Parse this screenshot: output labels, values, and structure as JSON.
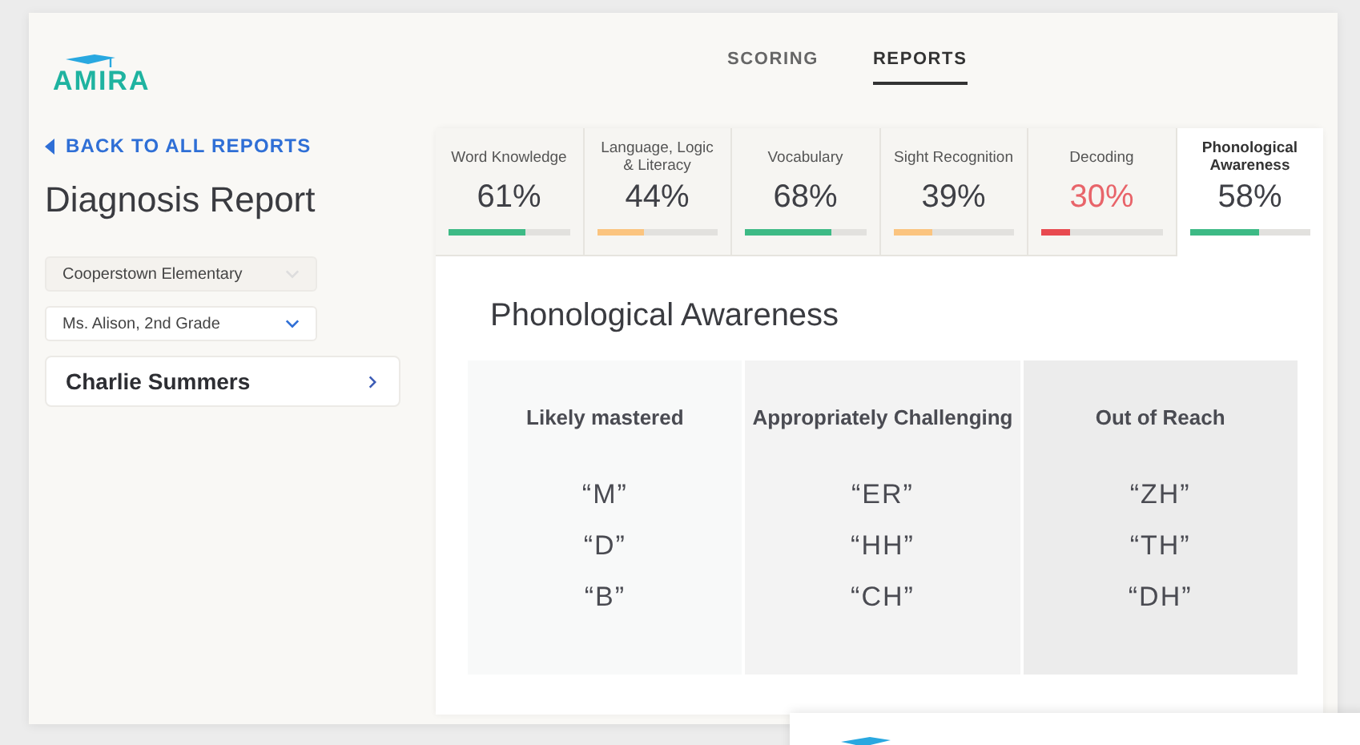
{
  "logo": {
    "text": "AMIRA"
  },
  "nav": [
    {
      "label": "SCORING",
      "selected": false
    },
    {
      "label": "REPORTS",
      "selected": true
    }
  ],
  "back_link": "BACK TO ALL REPORTS",
  "page_title": "Diagnosis Report",
  "filters": [
    {
      "value": "Cooperstown Elementary",
      "disabled": true
    },
    {
      "value": "Ms. Alison, 2nd Grade",
      "disabled": false
    }
  ],
  "student": "Charlie Summers",
  "skill_tabs": [
    {
      "label": "Word Knowledge",
      "value": "61%",
      "level": 0.64,
      "color": "#3dba85",
      "flagged": false,
      "selected": false
    },
    {
      "label": "Language, Logic & Literacy",
      "value": "44%",
      "level": 0.39,
      "color": "#fbc47f",
      "flagged": false,
      "selected": false
    },
    {
      "label": "Vocabulary",
      "value": "68%",
      "level": 0.71,
      "color": "#3dba85",
      "flagged": false,
      "selected": false
    },
    {
      "label": "Sight Recognition",
      "value": "39%",
      "level": 0.33,
      "color": "#fbc47f",
      "flagged": false,
      "selected": false
    },
    {
      "label": "Decoding",
      "value": "30%",
      "level": 0.24,
      "color": "#e84a50",
      "flagged": true,
      "selected": false
    },
    {
      "label": "Phonological Awareness",
      "value": "58%",
      "level": 0.58,
      "color": "#3dba85",
      "flagged": false,
      "selected": true
    }
  ],
  "section_title": "Phonological Awareness",
  "columns": [
    {
      "heading": "Likely mastered",
      "items": [
        "“M”",
        "“D”",
        "“B”"
      ]
    },
    {
      "heading": "Appropriately Challenging",
      "items": [
        "“ER”",
        "“HH”",
        "“CH”"
      ]
    },
    {
      "heading": "Out of Reach",
      "items": [
        "“ZH”",
        "“TH”",
        "“DH”"
      ]
    }
  ]
}
